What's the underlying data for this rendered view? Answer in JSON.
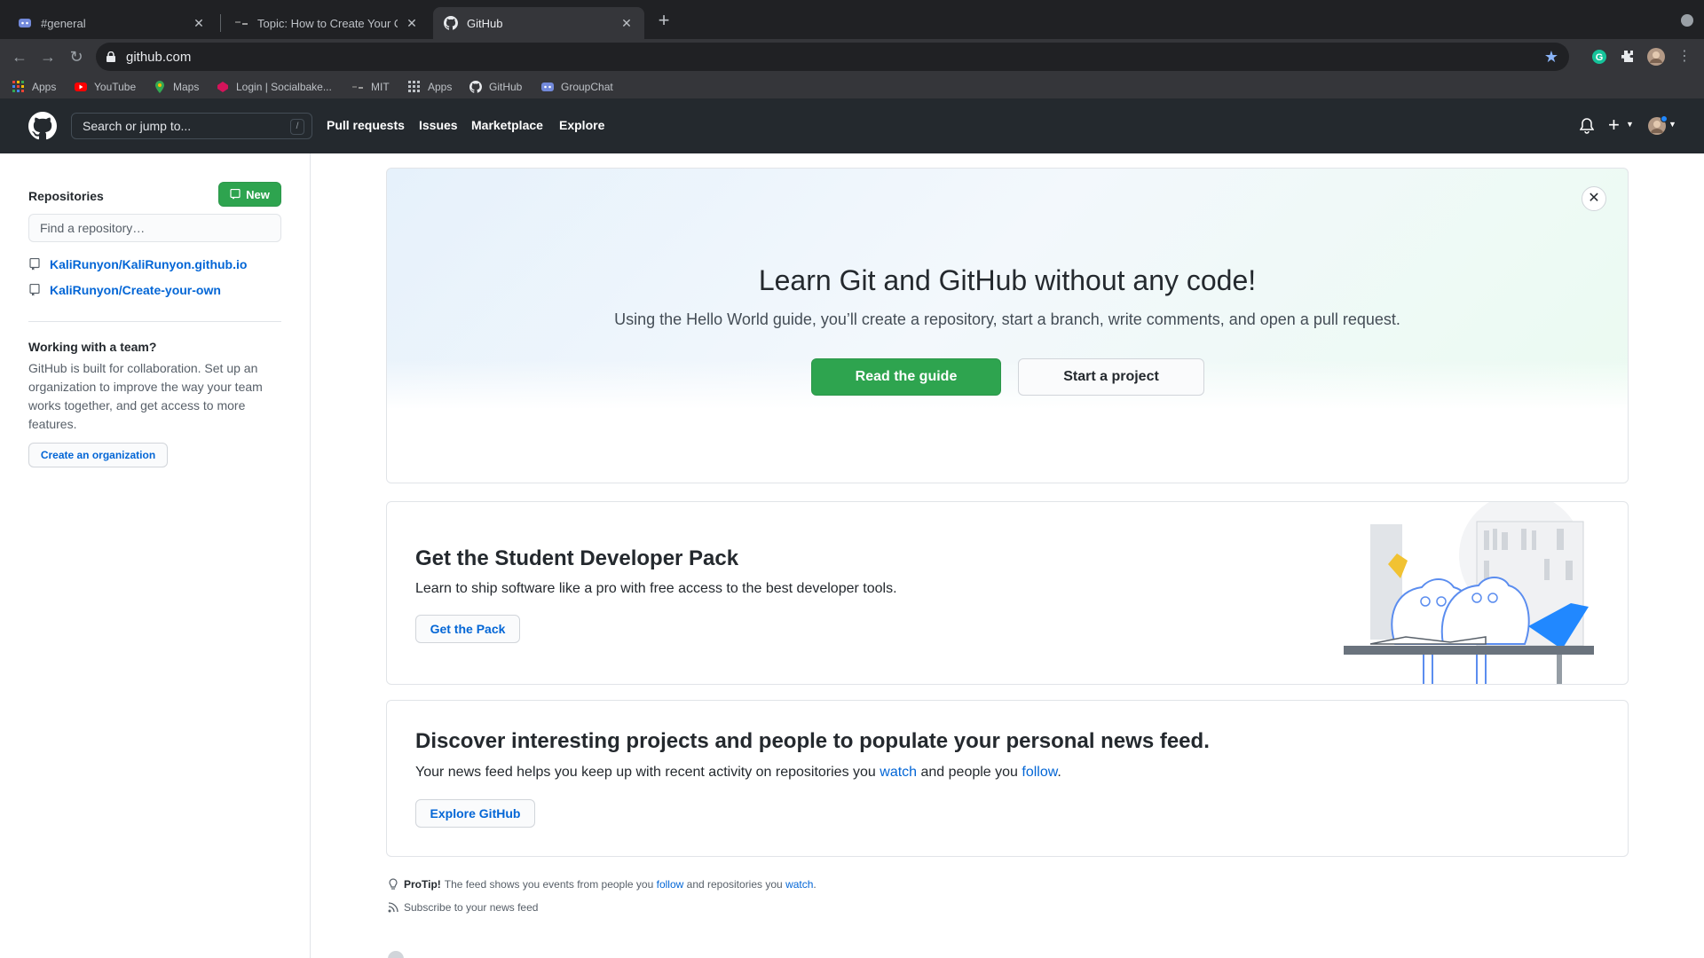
{
  "browser": {
    "tabs": [
      {
        "title": "#general",
        "icon": "discord-icon"
      },
      {
        "title": "Topic: How to Create Your Own",
        "icon": "forum-icon"
      },
      {
        "title": "GitHub",
        "icon": "github-icon"
      }
    ],
    "url": "github.com",
    "bookmarks": [
      {
        "label": "Apps",
        "icon": "apps-grid-icon"
      },
      {
        "label": "YouTube",
        "icon": "youtube-icon"
      },
      {
        "label": "Maps",
        "icon": "maps-pin-icon"
      },
      {
        "label": "Login | Socialbake...",
        "icon": "socialbakers-icon"
      },
      {
        "label": "MIT",
        "icon": "mit-icon"
      },
      {
        "label": "Apps",
        "icon": "apps-grid-icon"
      },
      {
        "label": "GitHub",
        "icon": "github-icon"
      },
      {
        "label": "GroupChat",
        "icon": "discord-icon"
      }
    ]
  },
  "header": {
    "search_placeholder": "Search or jump to...",
    "search_shortcut": "/",
    "nav": [
      "Pull requests",
      "Issues",
      "Marketplace",
      "Explore"
    ]
  },
  "sidebar": {
    "title": "Repositories",
    "new_label": "New",
    "find_placeholder": "Find a repository…",
    "repos": [
      "KaliRunyon/KaliRunyon.github.io",
      "KaliRunyon/Create-your-own"
    ],
    "team_title": "Working with a team?",
    "team_text": "GitHub is built for collaboration. Set up an organization to improve the way your team works together, and get access to more features.",
    "create_org_label": "Create an organization"
  },
  "hero": {
    "title": "Learn Git and GitHub without any code!",
    "subtitle": "Using the Hello World guide, you’ll create a repository, start a branch, write comments, and open a pull request.",
    "read_guide_label": "Read the guide",
    "start_project_label": "Start a project",
    "close_label": "✕"
  },
  "student": {
    "title": "Get the Student Developer Pack",
    "subtitle": "Learn to ship software like a pro with free access to the best developer tools.",
    "button_label": "Get the Pack"
  },
  "discover": {
    "title": "Discover interesting projects and people to populate your personal news feed.",
    "sub_before": "Your news feed helps you keep up with recent activity on repositories you ",
    "sub_watch": "watch",
    "sub_middle": " and people you ",
    "sub_follow": "follow",
    "sub_end": ".",
    "button_label": "Explore GitHub"
  },
  "protip": {
    "label": "ProTip!",
    "before": "The feed shows you events from people you ",
    "follow": "follow",
    "middle": " and repositories you ",
    "watch": "watch",
    "end": "."
  },
  "subscribe_label": "Subscribe to your news feed",
  "colors": {
    "header_bg": "#24292e",
    "primary_green": "#2ea44f",
    "link_blue": "#0366d6"
  }
}
